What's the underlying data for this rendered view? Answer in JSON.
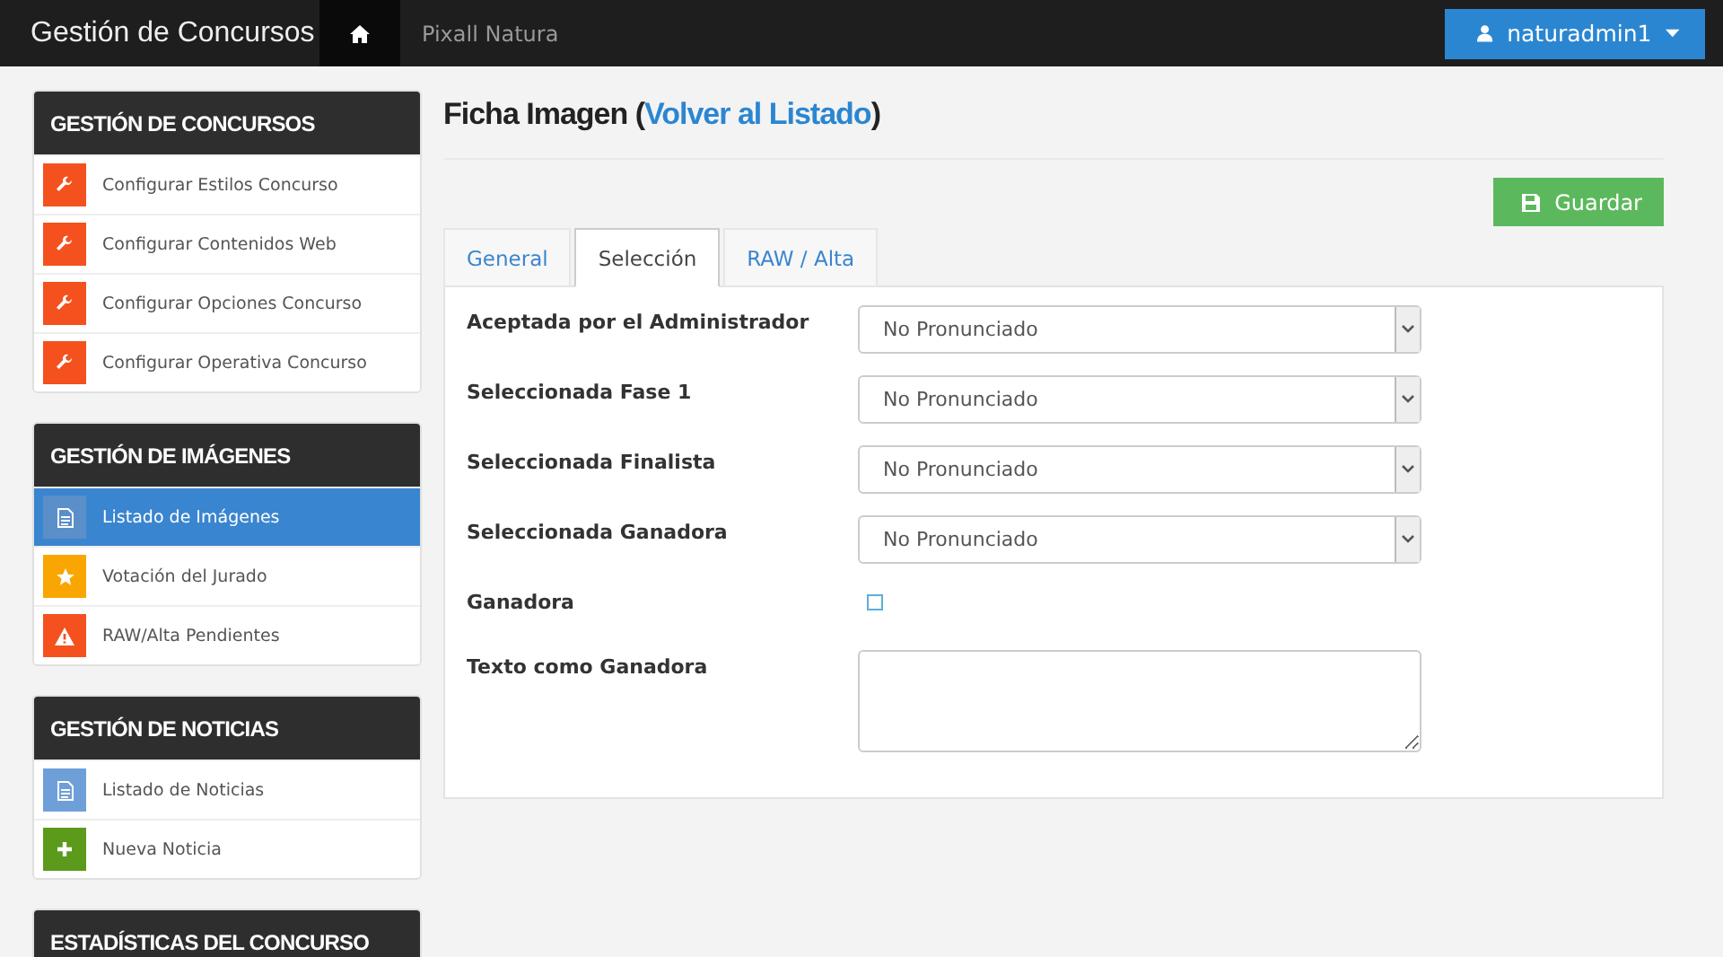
{
  "navbar": {
    "brand": "Gestión de Concursos",
    "home_selected": true,
    "site": "Pixall Natura",
    "user": "naturadmin1"
  },
  "sidebar": [
    {
      "title": "GESTIÓN DE CONCURSOS",
      "items": [
        {
          "label": "Configurar Estilos Concurso",
          "kind": "wrench",
          "color": "#f4511e",
          "selected": false
        },
        {
          "label": "Configurar Contenidos Web",
          "kind": "wrench",
          "color": "#f4511e",
          "selected": false
        },
        {
          "label": "Configurar Opciones Concurso",
          "kind": "wrench",
          "color": "#f4511e",
          "selected": false
        },
        {
          "label": "Configurar Operativa Concurso",
          "kind": "wrench",
          "color": "#f4511e",
          "selected": false
        }
      ]
    },
    {
      "title": "GESTIÓN DE IMÁGENES",
      "items": [
        {
          "label": "Listado de Imágenes",
          "kind": "document",
          "color": "#5b8fc9",
          "selected": true
        },
        {
          "label": "Votación del Jurado",
          "kind": "star",
          "color": "#f9a602",
          "selected": false
        },
        {
          "label": "RAW/Alta Pendientes",
          "kind": "warning",
          "color": "#f4511e",
          "selected": false
        }
      ]
    },
    {
      "title": "GESTIÓN DE NOTICIAS",
      "items": [
        {
          "label": "Listado de Noticias",
          "kind": "document",
          "color": "#6f9fd8",
          "selected": false
        },
        {
          "label": "Nueva Noticia",
          "kind": "plus",
          "color": "#5c9a1b",
          "selected": false
        }
      ]
    },
    {
      "title": "ESTADÍSTICAS DEL CONCURSO"
    }
  ],
  "page": {
    "title": "Ficha Imagen (",
    "link": "Volver al Listado",
    "title_end": ")",
    "save_button": "Guardar"
  },
  "tabs": [
    {
      "label": "General",
      "selected": false
    },
    {
      "label": "Selección",
      "selected": true
    },
    {
      "label": "RAW / Alta",
      "selected": false
    }
  ],
  "fields": [
    {
      "label": "Aceptada por el Administrador",
      "kind": "select",
      "value": "No Pronunciado"
    },
    {
      "label": "Seleccionada Fase 1",
      "kind": "select",
      "value": "No Pronunciado"
    },
    {
      "label": "Seleccionada Finalista",
      "kind": "select",
      "value": "No Pronunciado"
    },
    {
      "label": "Seleccionada Ganadora",
      "kind": "select",
      "value": "No Pronunciado"
    },
    {
      "label": "Ganadora",
      "kind": "checkbox",
      "checked": false
    },
    {
      "label": "Texto como Ganadora",
      "kind": "textarea"
    }
  ]
}
